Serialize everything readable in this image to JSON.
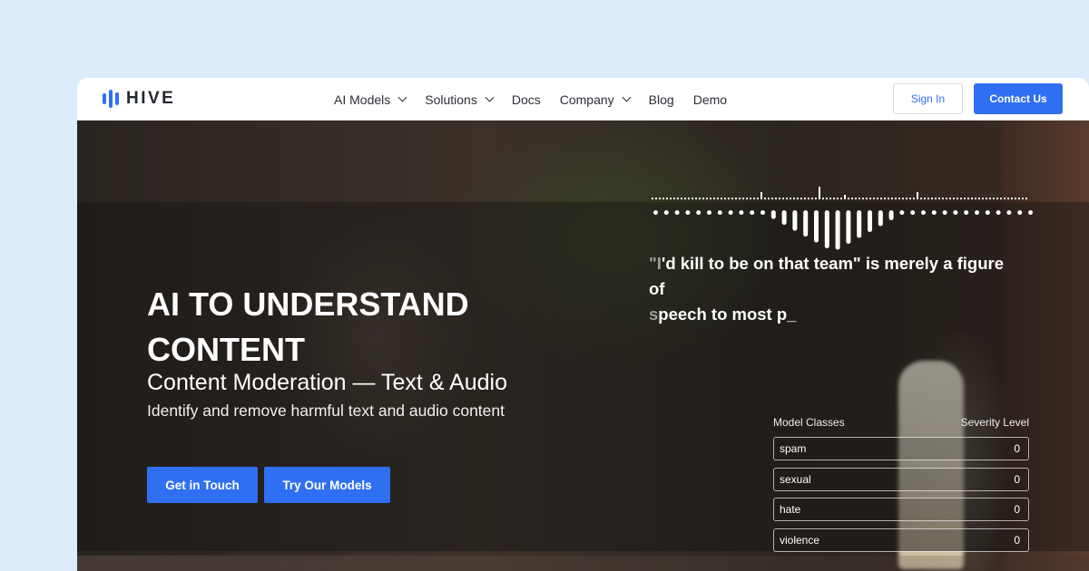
{
  "nav": {
    "logo_text": "HIVE",
    "menu": [
      {
        "label": "AI Models",
        "dropdown": true
      },
      {
        "label": "Solutions",
        "dropdown": true
      },
      {
        "label": "Docs",
        "dropdown": false
      },
      {
        "label": "Company",
        "dropdown": true
      },
      {
        "label": "Blog",
        "dropdown": false
      },
      {
        "label": "Demo",
        "dropdown": false
      }
    ],
    "sign_in": "Sign In",
    "contact": "Contact Us"
  },
  "hero": {
    "title": "AI TO UNDERSTAND CONTENT",
    "subtitle": "Content Moderation — Text & Audio",
    "description": "Identify and remove harmful text and audio content",
    "cta_primary": "Get in Touch",
    "cta_secondary": "Try Our Models"
  },
  "demo": {
    "transcript_lead": "\"I",
    "transcript": "'d kill to be on that team\" is merely a figure of ",
    "transcript_lead2": "s",
    "transcript2": "peech to most p_",
    "classes_header": "Model Classes",
    "severity_header": "Severity Level",
    "classes": [
      {
        "name": "spam",
        "level": "0"
      },
      {
        "name": "sexual",
        "level": "0"
      },
      {
        "name": "hate",
        "level": "0"
      },
      {
        "name": "violence",
        "level": "0"
      }
    ]
  },
  "colors": {
    "accent": "#2f6ff2",
    "page_bg": "#dcecfb"
  },
  "icons": {
    "logo": "hive-bars-icon",
    "dropdown": "chevron-down-icon",
    "waveform": "audio-waveform-icon"
  }
}
